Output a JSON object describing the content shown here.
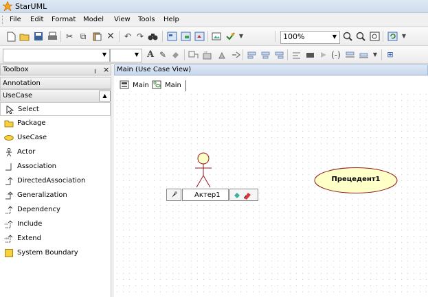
{
  "window": {
    "title": "StarUML"
  },
  "menu": [
    "File",
    "Edit",
    "Format",
    "Model",
    "View",
    "Tools",
    "Help"
  ],
  "toolbar": {
    "zoom": "100%"
  },
  "toolbox": {
    "title": "Toolbox",
    "pin": "।",
    "close": "×",
    "categories": {
      "annotation": "Annotation",
      "usecase": "UseCase"
    },
    "tools": [
      {
        "label": "Select",
        "icon": "cursor-icon"
      },
      {
        "label": "Package",
        "icon": "package-icon"
      },
      {
        "label": "UseCase",
        "icon": "usecase-icon"
      },
      {
        "label": "Actor",
        "icon": "actor-icon"
      },
      {
        "label": "Association",
        "icon": "association-icon"
      },
      {
        "label": "DirectedAssociation",
        "icon": "directed-association-icon"
      },
      {
        "label": "Generalization",
        "icon": "generalization-icon"
      },
      {
        "label": "Dependency",
        "icon": "dependency-icon"
      },
      {
        "label": "Include",
        "icon": "include-icon"
      },
      {
        "label": "Extend",
        "icon": "extend-icon"
      },
      {
        "label": "System Boundary",
        "icon": "system-boundary-icon"
      }
    ]
  },
  "view": {
    "title": "Main (Use Case View)",
    "tabs": [
      "Main",
      "Main"
    ]
  },
  "diagram": {
    "actor_name": "Актер1",
    "usecase_name": "Прецедент1"
  },
  "colors": {
    "usecase_fill": "#ffffc8",
    "usecase_stroke": "#8b1a1a",
    "actor_stroke": "#8b1a1a"
  }
}
